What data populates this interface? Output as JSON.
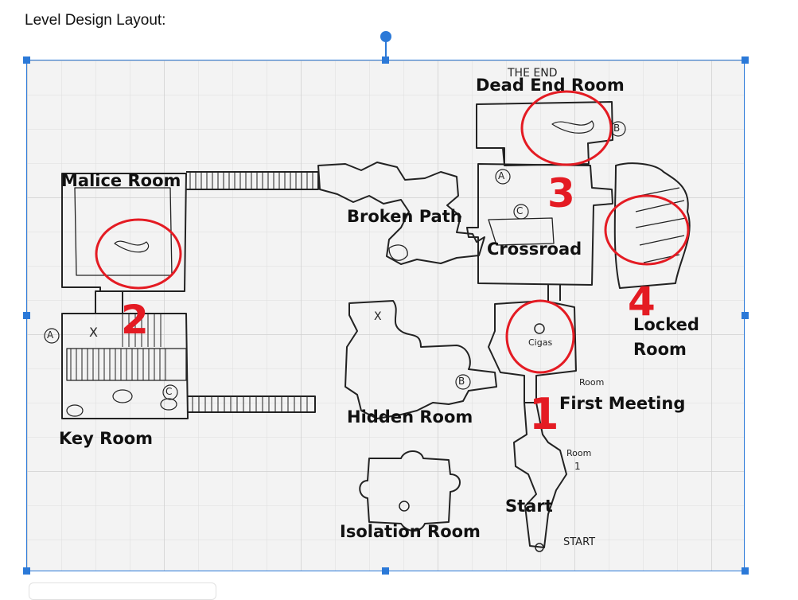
{
  "document": {
    "heading": "Level Design Layout:"
  },
  "labels": {
    "dead_end_room": "Dead End Room",
    "malice_room": "Malice Room",
    "broken_path": "Broken Path",
    "crossroad": "Crossroad",
    "locked_room": "Locked Room",
    "locked_room_line1": "Locked",
    "locked_room_line2": "Room",
    "key_room": "Key Room",
    "hidden_room": "Hidden Room",
    "first_meeting": "First Meeting",
    "start": "Start",
    "isolation_room": "Isolation Room"
  },
  "markers": {
    "m1": "1",
    "m2": "2",
    "m3": "3",
    "m4": "4"
  },
  "sketch_notes": {
    "the_end": "THE END",
    "cigas": "Cigas",
    "room": "Room",
    "room_1_a": "Room",
    "room_1_b": "1",
    "start_small": "START",
    "letter_a1": "A",
    "letter_a2": "A",
    "letter_b1": "B",
    "letter_b2": "B",
    "letter_c1": "C",
    "letter_c2": "C",
    "x1": "X",
    "x2": "X"
  },
  "colors": {
    "selection": "#2b79d8",
    "marker": "#e41b23",
    "canvas": "#f3f3f3",
    "grid": "#dcdcdc"
  }
}
